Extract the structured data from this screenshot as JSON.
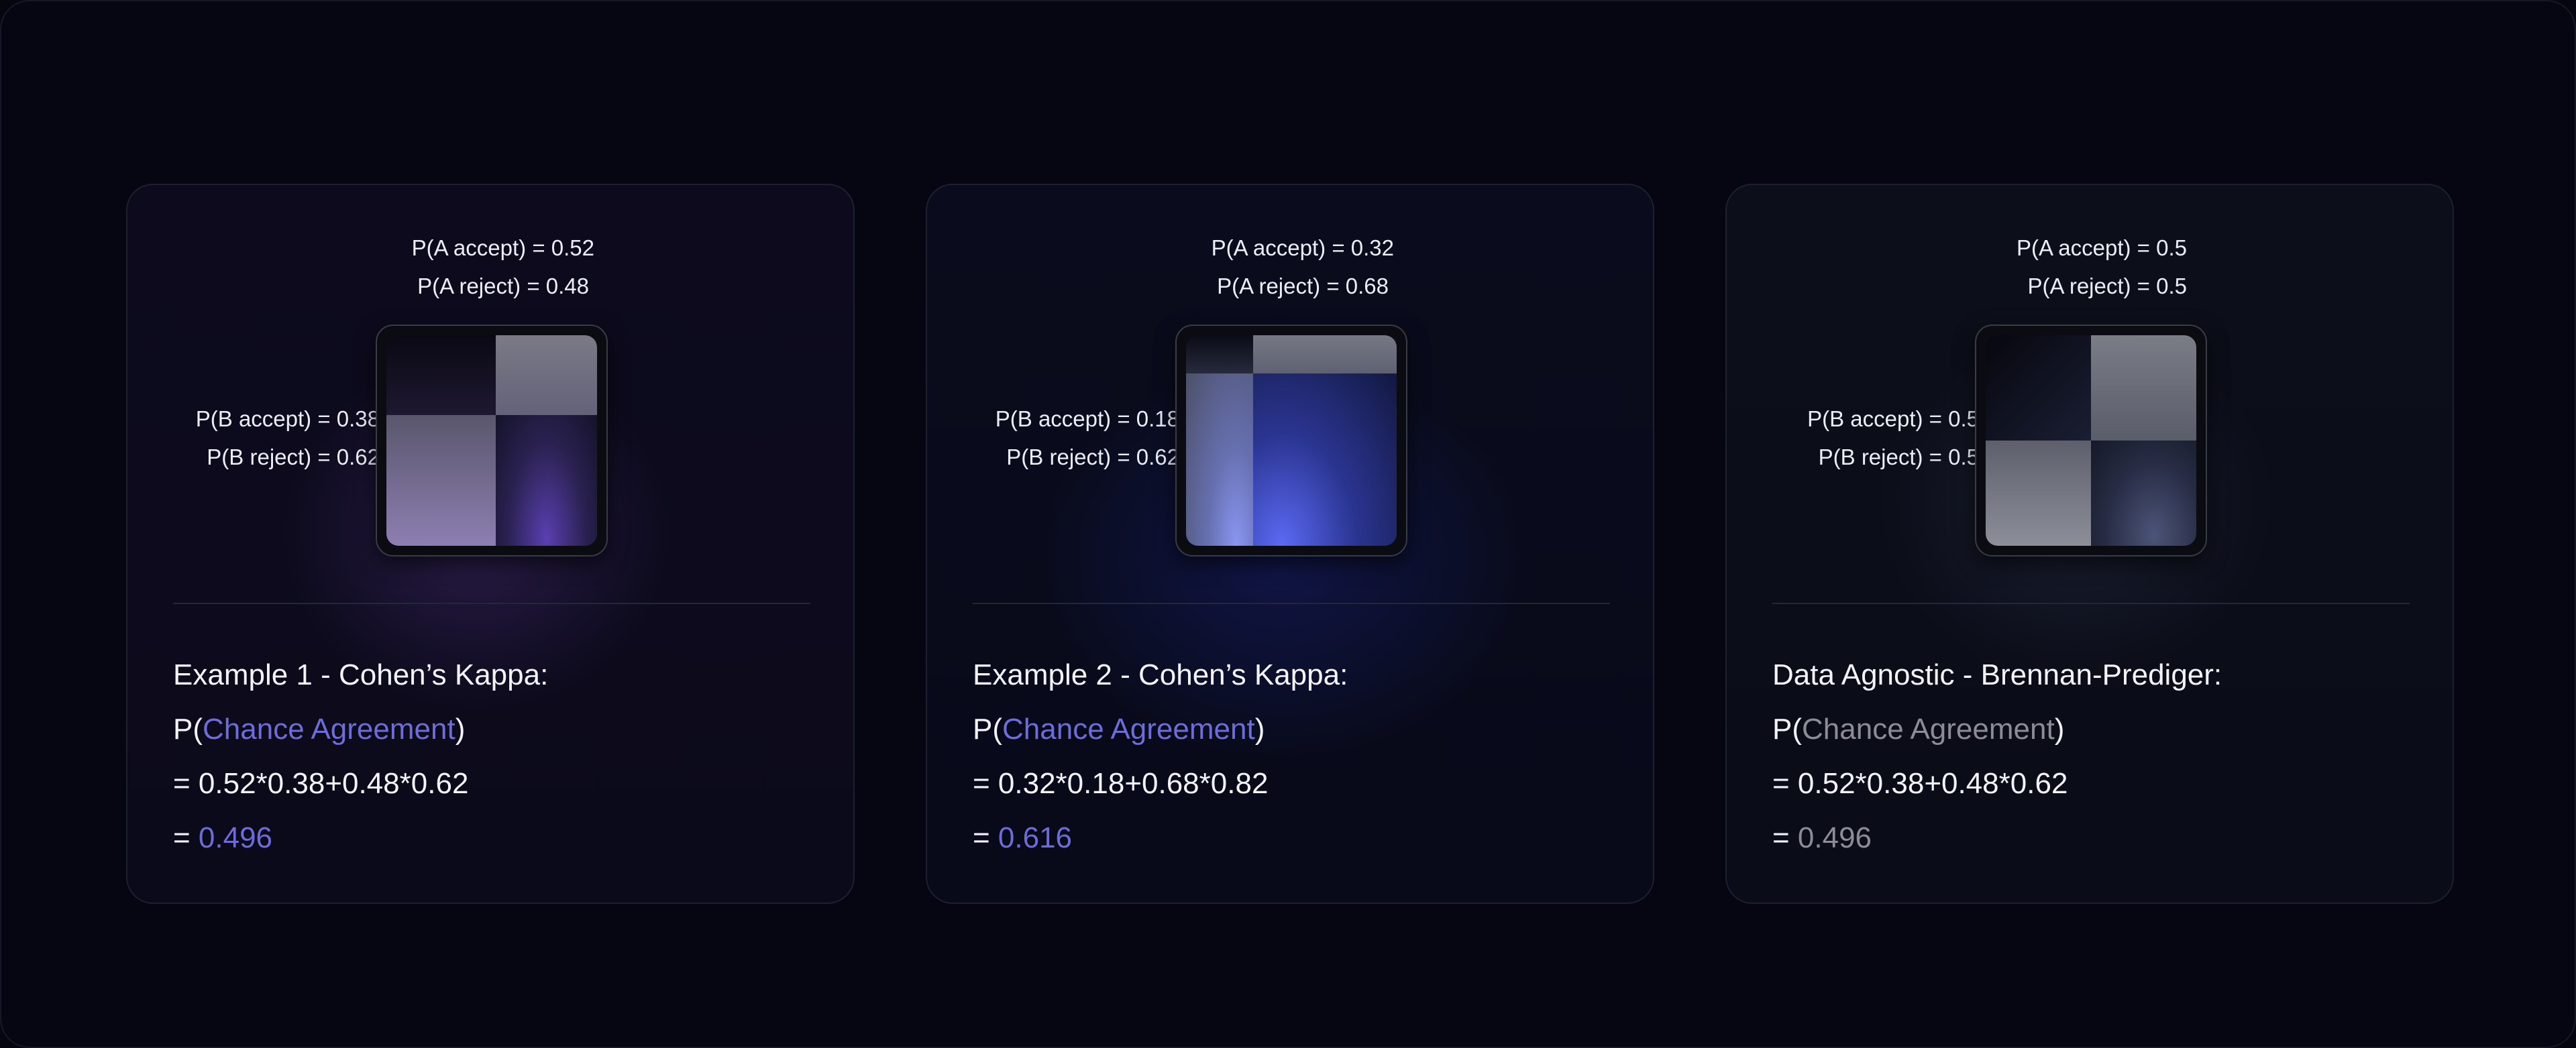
{
  "colors": {
    "background": "#05060f",
    "accent": "#6d6cd8",
    "accent_neutral": "#8b8c95",
    "text": "#f3f4fa"
  },
  "cards": [
    {
      "a_accept": "P(A accept) = 0.52",
      "a_reject": "P(A reject) = 0.48",
      "b_accept": "P(B accept) = 0.38",
      "b_reject": "P(B reject) = 0.62",
      "split_col": 0.52,
      "split_row": 0.38,
      "title": "Example 1 - Cohen’s Kappa:",
      "p_open": "P(",
      "chance_agreement": "Chance Agreement",
      "p_close": ")",
      "equation": "= 0.52*0.38+0.48*0.62",
      "result_prefix": "= ",
      "result": "0.496"
    },
    {
      "a_accept": "P(A accept) = 0.32",
      "a_reject": "P(A reject) = 0.68",
      "b_accept": "P(B accept) = 0.18",
      "b_reject": "P(B reject) = 0.62",
      "split_col": 0.32,
      "split_row": 0.18,
      "title": "Example 2 - Cohen’s Kappa:",
      "p_open": "P(",
      "chance_agreement": "Chance Agreement",
      "p_close": ")",
      "equation": "= 0.32*0.18+0.68*0.82",
      "result_prefix": "= ",
      "result": "0.616"
    },
    {
      "a_accept": "P(A accept) = 0.5",
      "a_reject": "P(A reject) = 0.5",
      "b_accept": "P(B accept) = 0.5",
      "b_reject": "P(B reject) = 0.5",
      "split_col": 0.5,
      "split_row": 0.5,
      "title": "Data Agnostic - Brennan-Prediger:",
      "p_open": "P(",
      "chance_agreement": "Chance Agreement",
      "p_close": ")",
      "equation": "= 0.52*0.38+0.48*0.62",
      "result_prefix": "= ",
      "result": "0.496"
    }
  ]
}
